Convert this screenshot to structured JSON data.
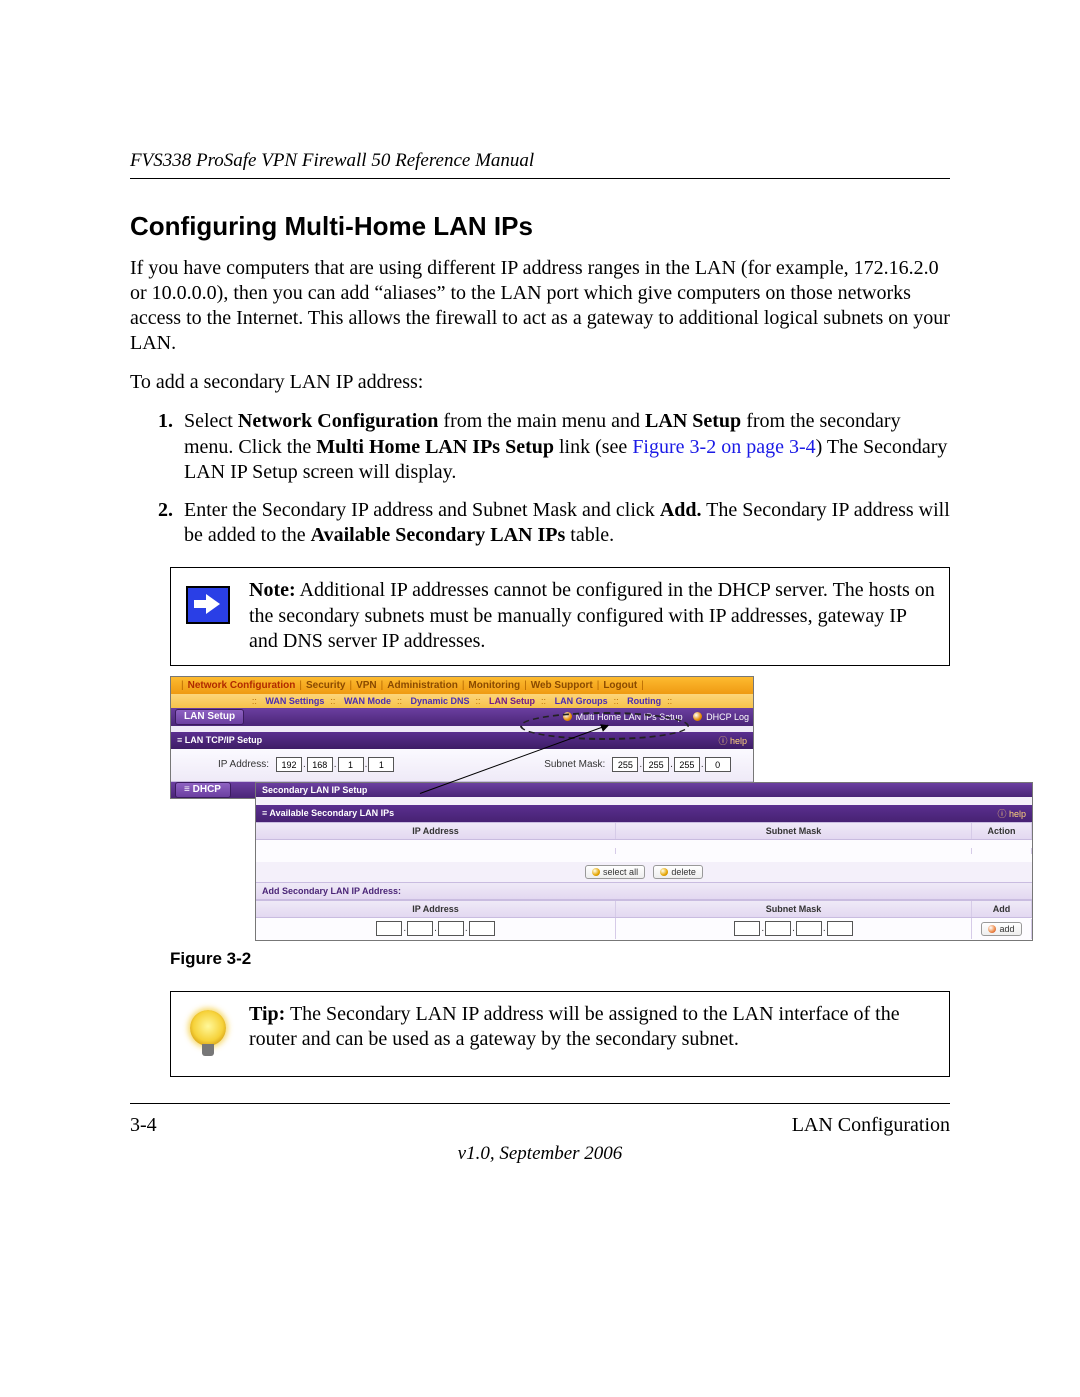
{
  "doc_header": "FVS338 ProSafe VPN Firewall 50 Reference Manual",
  "heading": "Configuring Multi-Home LAN IPs",
  "intro": "If you have computers that are using different IP address ranges in the LAN (for example, 172.16.2.0 or 10.0.0.0), then you can add “aliases” to the LAN port which give computers on those networks access to the Internet. This allows the firewall to act as a gateway to additional logical subnets on your LAN.",
  "lead_in": "To add a secondary LAN IP address:",
  "steps": {
    "s1_a": "Select ",
    "s1_b": "Network Configuration",
    "s1_c": " from the main menu and ",
    "s1_d": "LAN Setup",
    "s1_e": " from the secondary menu. Click the ",
    "s1_f": "Multi Home LAN IPs Setup",
    "s1_g": " link (see ",
    "s1_xref": "Figure 3-2 on page 3-4",
    "s1_h": ") The Secondary LAN IP Setup screen will display.",
    "s2_a": "Enter the Secondary IP address and Subnet Mask and click ",
    "s2_b": "Add.",
    "s2_c": " The Secondary IP address will be added to the ",
    "s2_d": "Available Secondary LAN IPs",
    "s2_e": " table."
  },
  "note": {
    "label": "Note:",
    "text": " Additional IP addresses cannot be configured in the DHCP server. The hosts on the secondary subnets must be manually configured with IP addresses, gateway IP and DNS server IP addresses."
  },
  "figure_caption": "Figure 3-2",
  "tip": {
    "label": "Tip:",
    "text": " The Secondary LAN IP address will be assigned to the LAN interface of the router and can be used as a gateway by the secondary subnet."
  },
  "footer": {
    "left": "3-4",
    "right": "LAN Configuration",
    "version": "v1.0, September 2006"
  },
  "ui": {
    "main_nav": [
      "Network Configuration",
      "Security",
      "VPN",
      "Administration",
      "Monitoring",
      "Web Support",
      "Logout"
    ],
    "sub_nav": [
      "WAN Settings",
      "WAN Mode",
      "Dynamic DNS",
      "LAN Setup",
      "LAN Groups",
      "Routing"
    ],
    "tab_lan_setup": "LAN Setup",
    "link_multi_home": "Multi Home LAN IPs Setup",
    "link_dhcp_log": "DHCP Log",
    "section_tcpip": "LAN TCP/IP Setup",
    "help": "help",
    "ip_label": "IP Address:",
    "mask_label": "Subnet Mask:",
    "ip_octets": [
      "192",
      "168",
      "1",
      "1"
    ],
    "mask_octets": [
      "255",
      "255",
      "255",
      "0"
    ],
    "dhcp_tab": "DHCP",
    "section_secondary": "Secondary LAN IP Setup",
    "section_available": "Available Secondary LAN IPs",
    "col_ip": "IP Address",
    "col_mask": "Subnet Mask",
    "col_action": "Action",
    "col_add": "Add",
    "btn_select_all": "select all",
    "btn_delete": "delete",
    "btn_add": "add",
    "add_row_label": "Add Secondary LAN IP Address:"
  }
}
